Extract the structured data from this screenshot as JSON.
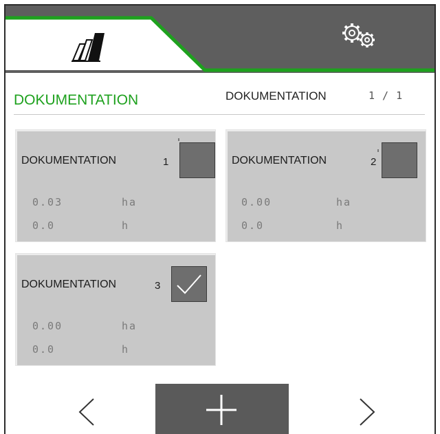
{
  "header": {
    "title": "DOKUMENTATION",
    "section_label": "DOKUMENTATION",
    "pager": "1 / 1"
  },
  "tabs": [
    {
      "name": "machine",
      "icon": "machine-icon",
      "active": true
    },
    {
      "name": "settings",
      "icon": "gear-icon",
      "active": false
    }
  ],
  "cards": [
    {
      "name": "DOKUMENTATION",
      "number": "1",
      "area": "0.03",
      "area_unit": "ha",
      "time": "0.0",
      "time_unit": "h",
      "checked": false
    },
    {
      "name": "DOKUMENTATION",
      "number": "2",
      "area": "0.00",
      "area_unit": "ha",
      "time": "0.0",
      "time_unit": "h",
      "checked": false
    },
    {
      "name": "DOKUMENTATION",
      "number": "3",
      "area": "0.00",
      "area_unit": "ha",
      "time": "0.0",
      "time_unit": "h",
      "checked": true
    }
  ],
  "colors": {
    "accent": "#1ea11e",
    "tab_dark": "#5e5e5e",
    "card_bg": "#c8c8c8",
    "checkbox": "#6e6e6e",
    "button": "#5a5a5a"
  },
  "nav": {
    "prev_icon": "chevron-left-icon",
    "next_icon": "chevron-right-icon",
    "add_icon": "plus-icon"
  }
}
